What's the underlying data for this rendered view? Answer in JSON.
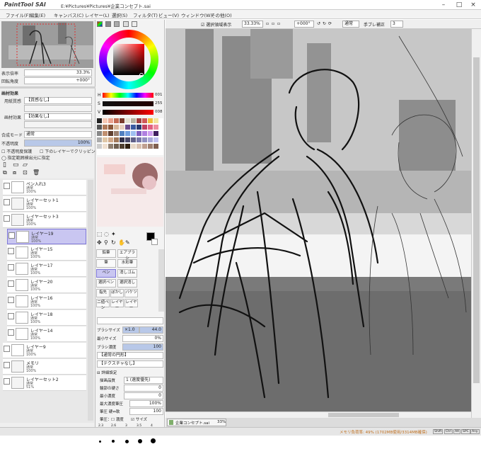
{
  "app": {
    "logo_text": "PaintTool SAI",
    "title": "E:¥Pictures¥Pictures¥企業コンセプト.sai"
  },
  "menu": [
    "ファイル(F)",
    "編集(E)",
    "キャンバス(C)",
    "レイヤー(L)",
    "選択(S)",
    "フィルタ(T)",
    "ビュー(V)",
    "ウィンドウ(W)",
    "その他(O)"
  ],
  "navigator": {
    "zoom_label": "表示倍率",
    "zoom_value": "33.3%",
    "rotate_label": "回転角度",
    "rotate_value": "+000°"
  },
  "layer_panel": {
    "section_label": "画材効果",
    "paper_label": "用紙質感",
    "paper_value": "【質感なし】",
    "effect_label": "画材効果",
    "effect_value": "【効果なし】",
    "blend_label": "合成モード",
    "blend_value": "通常",
    "opacity_label": "不透明度",
    "opacity_value": "100%",
    "protect_label": "不透明度保護",
    "clip_label": "下のレイヤーでクリッピング",
    "source_label": "指定範囲検出元に指定",
    "layers": [
      {
        "name": "ペン入れ3",
        "mode": "通常",
        "pct": "100%",
        "type": "layer"
      },
      {
        "name": "レイヤーセット1",
        "mode": "通常",
        "pct": "100%",
        "type": "folder"
      },
      {
        "name": "レイヤーセット3",
        "mode": "通常",
        "pct": "100%",
        "type": "folder"
      },
      {
        "name": "レイヤー19",
        "mode": "通常",
        "pct": "100%",
        "type": "layer",
        "selected": true
      },
      {
        "name": "レイヤー15",
        "mode": "通常",
        "pct": "100%",
        "type": "layer"
      },
      {
        "name": "レイヤー17",
        "mode": "通常",
        "pct": "100%",
        "type": "layer"
      },
      {
        "name": "レイヤー20",
        "mode": "通常",
        "pct": "100%",
        "type": "layer"
      },
      {
        "name": "レイヤー16",
        "mode": "通常",
        "pct": "100%",
        "type": "layer"
      },
      {
        "name": "レイヤー18",
        "mode": "通常",
        "pct": "100%",
        "type": "layer"
      },
      {
        "name": "レイヤー14",
        "mode": "通常",
        "pct": "100%",
        "type": "layer"
      },
      {
        "name": "レイヤー9",
        "mode": "通常",
        "pct": "100%",
        "type": "layer"
      },
      {
        "name": "メモリ",
        "mode": "通常",
        "pct": "100%",
        "type": "folder"
      },
      {
        "name": "レイヤーセット2",
        "mode": "通常",
        "pct": "51%",
        "type": "folder"
      }
    ]
  },
  "color": {
    "h_label": "H",
    "h_value": "001",
    "s_label": "S",
    "s_value": "255",
    "v_label": "V",
    "v_value": "008"
  },
  "tools": {
    "row1": [
      "鉛筆",
      "エアブラシ"
    ],
    "row2": [
      "筆",
      "水彩筆"
    ],
    "row3": [
      "ペン",
      "消しゴム"
    ],
    "row4": [
      "選択ペン",
      "選択消し"
    ],
    "row5": [
      "指先",
      "ぼかし",
      "バケツ"
    ],
    "row6": [
      "二値ペン",
      "レイヤー",
      "レイヤー"
    ],
    "brush_size_label": "ブラシサイズ",
    "brush_size_mult": "×1.0",
    "brush_size_value": "44.0",
    "min_size_label": "最小サイズ",
    "min_size_value": "0%",
    "density_label": "ブラシ濃度",
    "density_value": "100",
    "shape_label": "【通常の円形】",
    "texture_label": "【テクスチャなし】",
    "detail_label": "詳細設定",
    "quality_label": "描画品質",
    "quality_value": "1 (速度優先)",
    "edge_label": "輪郭の硬さ",
    "edge_value": "0",
    "min_density_label": "最小濃度",
    "min_density_value": "0",
    "max_density_label": "最大濃度筆圧",
    "max_density_value": "100%",
    "pressure_label": "筆圧 硬⇔軟",
    "pressure_value": "100",
    "pressure_opts_label": "筆圧：",
    "pressure_density": "濃度",
    "pressure_size": "サイズ",
    "sizes": [
      "2.3",
      "2.6",
      "3",
      "3.5",
      "4",
      "5",
      "6",
      "7",
      "8",
      "9"
    ]
  },
  "toolbar": {
    "select_show_label": "選択領域表示",
    "zoom_value": "33.33%",
    "angle_value": "+000°",
    "mode_value": "通常",
    "stabilizer_label": "手ブレ補正",
    "stabilizer_value": "3"
  },
  "tab": {
    "name": "企業コンセプト.sai",
    "zoom": "33%"
  },
  "status": {
    "memory": "メモリ負荷率: 49% (1702MB使用/3314MB確保)",
    "keys": [
      "Shift",
      "Ctrl",
      "Alt",
      "SPC",
      "Any"
    ]
  },
  "colors": {
    "selected_layer": "#c9c6f1",
    "accent": "#7f78d9"
  }
}
